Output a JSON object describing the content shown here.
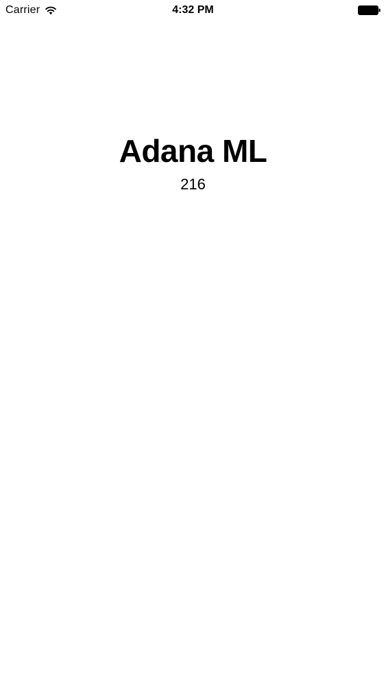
{
  "status_bar": {
    "carrier": "Carrier",
    "time": "4:32 PM",
    "wifi_icon": "wifi-icon",
    "battery_icon": "battery-icon"
  },
  "main": {
    "title": "Adana ML",
    "value": "216"
  },
  "colors": {
    "background": "#ffffff",
    "text": "#000000"
  }
}
